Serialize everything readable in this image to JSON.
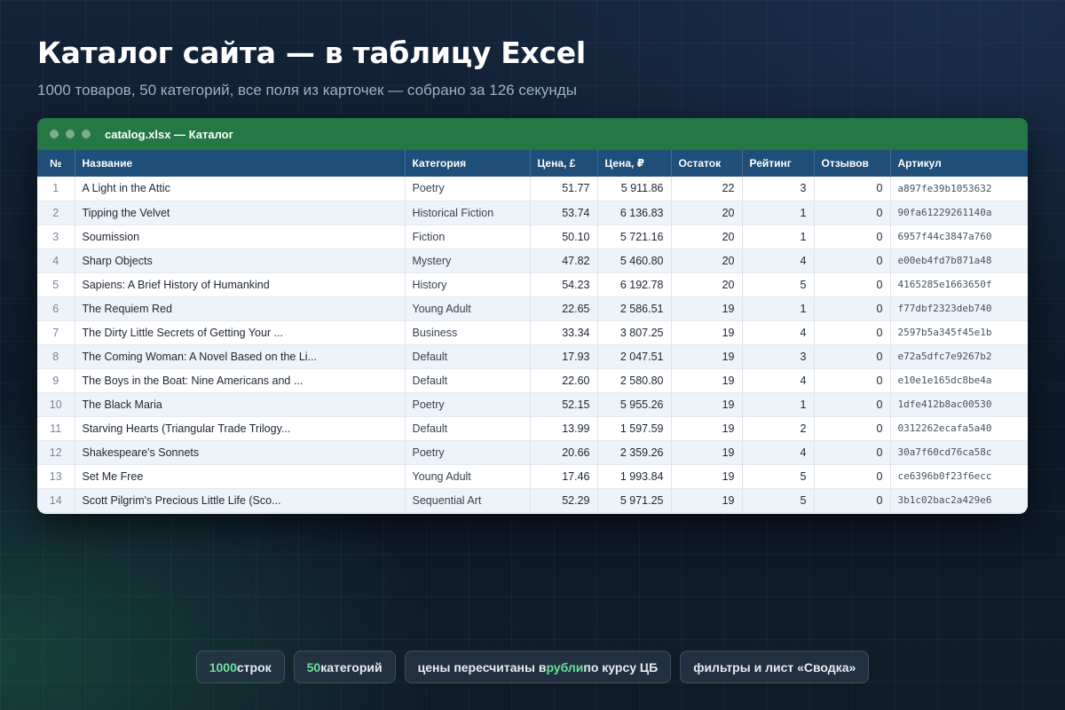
{
  "header": {
    "title": "Каталог сайта — в таблицу Excel",
    "subtitle": "1000 товаров, 50 категорий, все поля из карточек — собрано за 126 секунды"
  },
  "window": {
    "title": "catalog.xlsx — Каталог"
  },
  "table": {
    "columns": [
      "№",
      "Название",
      "Категория",
      "Цена, £",
      "Цена, ₽",
      "Остаток",
      "Рейтинг",
      "Отзывов",
      "Артикул"
    ],
    "rows": [
      [
        "1",
        "A Light in the Attic",
        "Poetry",
        "51.77",
        "5 911.86",
        "22",
        "3",
        "0",
        "a897fe39b1053632"
      ],
      [
        "2",
        "Tipping the Velvet",
        "Historical Fiction",
        "53.74",
        "6 136.83",
        "20",
        "1",
        "0",
        "90fa61229261140a"
      ],
      [
        "3",
        "Soumission",
        "Fiction",
        "50.10",
        "5 721.16",
        "20",
        "1",
        "0",
        "6957f44c3847a760"
      ],
      [
        "4",
        "Sharp Objects",
        "Mystery",
        "47.82",
        "5 460.80",
        "20",
        "4",
        "0",
        "e00eb4fd7b871a48"
      ],
      [
        "5",
        "Sapiens: A Brief History of Humankind",
        "History",
        "54.23",
        "6 192.78",
        "20",
        "5",
        "0",
        "4165285e1663650f"
      ],
      [
        "6",
        "The Requiem Red",
        "Young Adult",
        "22.65",
        "2 586.51",
        "19",
        "1",
        "0",
        "f77dbf2323deb740"
      ],
      [
        "7",
        "The Dirty Little Secrets of Getting Your ...",
        "Business",
        "33.34",
        "3 807.25",
        "19",
        "4",
        "0",
        "2597b5a345f45e1b"
      ],
      [
        "8",
        "The Coming Woman: A Novel Based on the Li...",
        "Default",
        "17.93",
        "2 047.51",
        "19",
        "3",
        "0",
        "e72a5dfc7e9267b2"
      ],
      [
        "9",
        "The Boys in the Boat: Nine Americans and ...",
        "Default",
        "22.60",
        "2 580.80",
        "19",
        "4",
        "0",
        "e10e1e165dc8be4a"
      ],
      [
        "10",
        "The Black Maria",
        "Poetry",
        "52.15",
        "5 955.26",
        "19",
        "1",
        "0",
        "1dfe412b8ac00530"
      ],
      [
        "11",
        "Starving Hearts (Triangular Trade Trilogy...",
        "Default",
        "13.99",
        "1 597.59",
        "19",
        "2",
        "0",
        "0312262ecafa5a40"
      ],
      [
        "12",
        "Shakespeare's Sonnets",
        "Poetry",
        "20.66",
        "2 359.26",
        "19",
        "4",
        "0",
        "30a7f60cd76ca58c"
      ],
      [
        "13",
        "Set Me Free",
        "Young Adult",
        "17.46",
        "1 993.84",
        "19",
        "5",
        "0",
        "ce6396b0f23f6ecc"
      ],
      [
        "14",
        "Scott Pilgrim's Precious Little Life (Sco...",
        "Sequential Art",
        "52.29",
        "5 971.25",
        "19",
        "5",
        "0",
        "3b1c02bac2a429e6"
      ]
    ]
  },
  "chips": [
    {
      "highlight": "1000",
      "pre": "",
      "post": " строк"
    },
    {
      "highlight": "50",
      "pre": "",
      "post": " категорий"
    },
    {
      "highlight": "рубли",
      "pre": "цены пересчитаны в ",
      "post": " по курсу ЦБ"
    },
    {
      "highlight": "",
      "pre": "фильтры и лист «Сводка»",
      "post": ""
    }
  ],
  "colors": {
    "titlebar": "#237843",
    "header_row": "#1f4e79",
    "highlight": "#6fe09a"
  }
}
